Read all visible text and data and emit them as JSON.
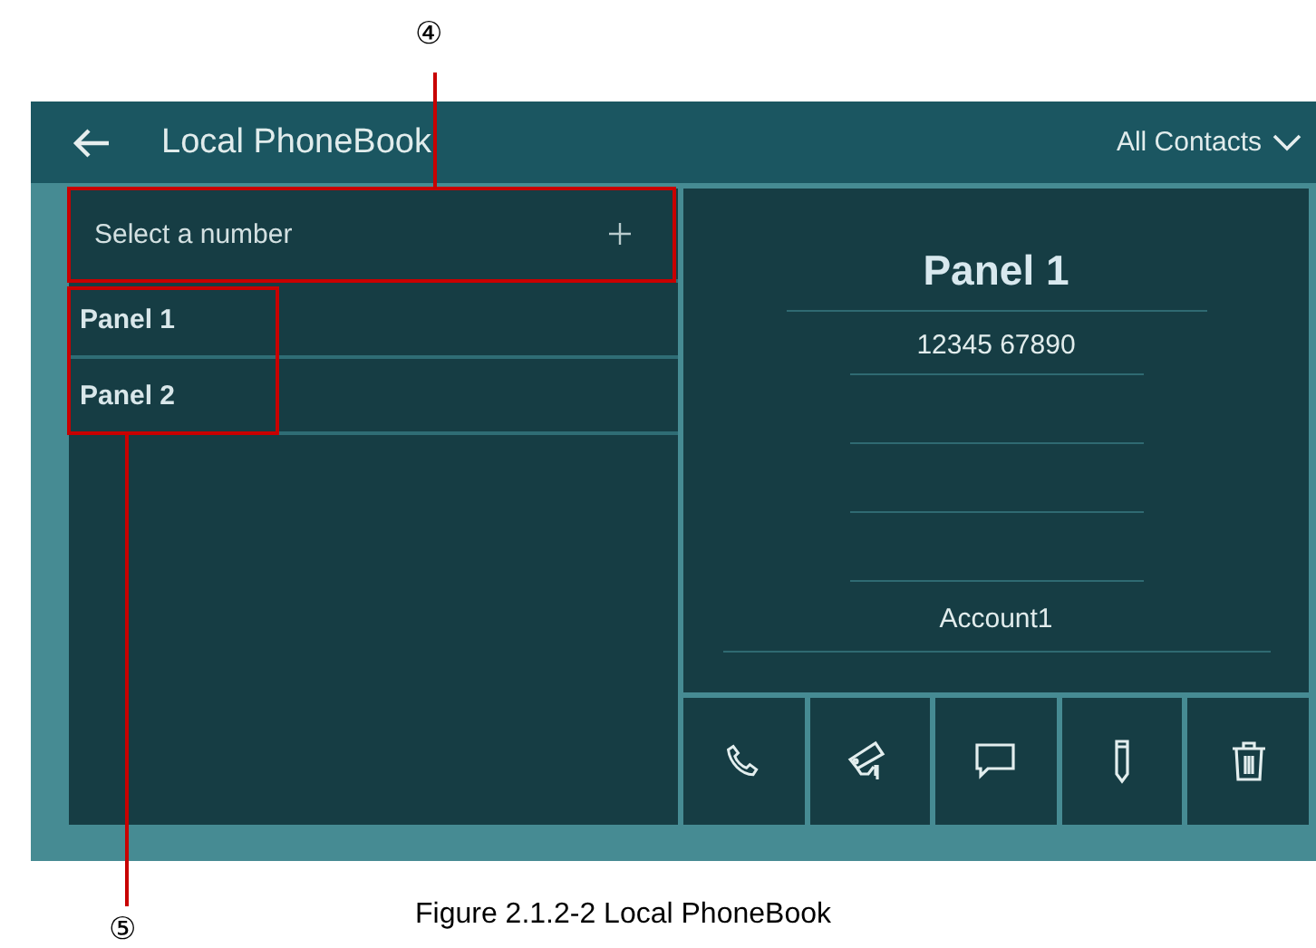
{
  "callouts": [
    {
      "label": "④"
    },
    {
      "label": "⑤"
    }
  ],
  "header": {
    "title": "Local PhoneBook",
    "filter": "All Contacts"
  },
  "search": {
    "placeholder": "Select a number"
  },
  "contacts": [
    {
      "name": "Panel 1"
    },
    {
      "name": "Panel 2"
    }
  ],
  "detail": {
    "name": "Panel 1",
    "number": "12345 67890",
    "account": "Account1"
  },
  "actions": [
    {
      "kind": "call"
    },
    {
      "kind": "monitor"
    },
    {
      "kind": "message"
    },
    {
      "kind": "edit"
    },
    {
      "kind": "delete"
    }
  ],
  "caption": "Figure 2.1.2-2 Local PhoneBook"
}
